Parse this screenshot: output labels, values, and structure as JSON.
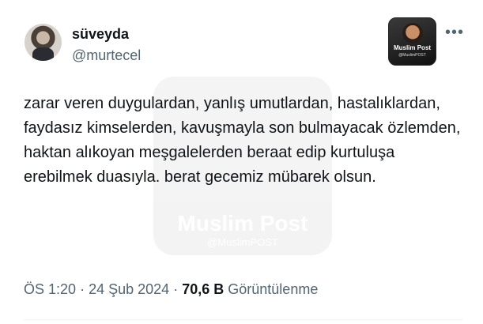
{
  "tweet": {
    "display_name": "süveyda",
    "handle": "@murtecel",
    "text": "zarar veren duygulardan, yanlış umutlardan, hastalıklardan, faydasız kimselerden, kavuşmayla son bulmayacak özlemden, haktan alıkoyan meşgalelerden beraat edip kurtuluşa erebilmek duasıyla. berat gecemiz mübarek olsun.",
    "time": "ÖS 1:20",
    "separator": "·",
    "date": "24 Şub 2024",
    "views_count": "70,6 B",
    "views_label": "Görüntülenme",
    "more_icon": "more-horizontal-icon"
  },
  "badge": {
    "title": "Muslim Post",
    "subtitle": "@MuslimPOST"
  },
  "watermark": {
    "title": "Muslim Post",
    "subtitle": "@MuslimPOST"
  }
}
